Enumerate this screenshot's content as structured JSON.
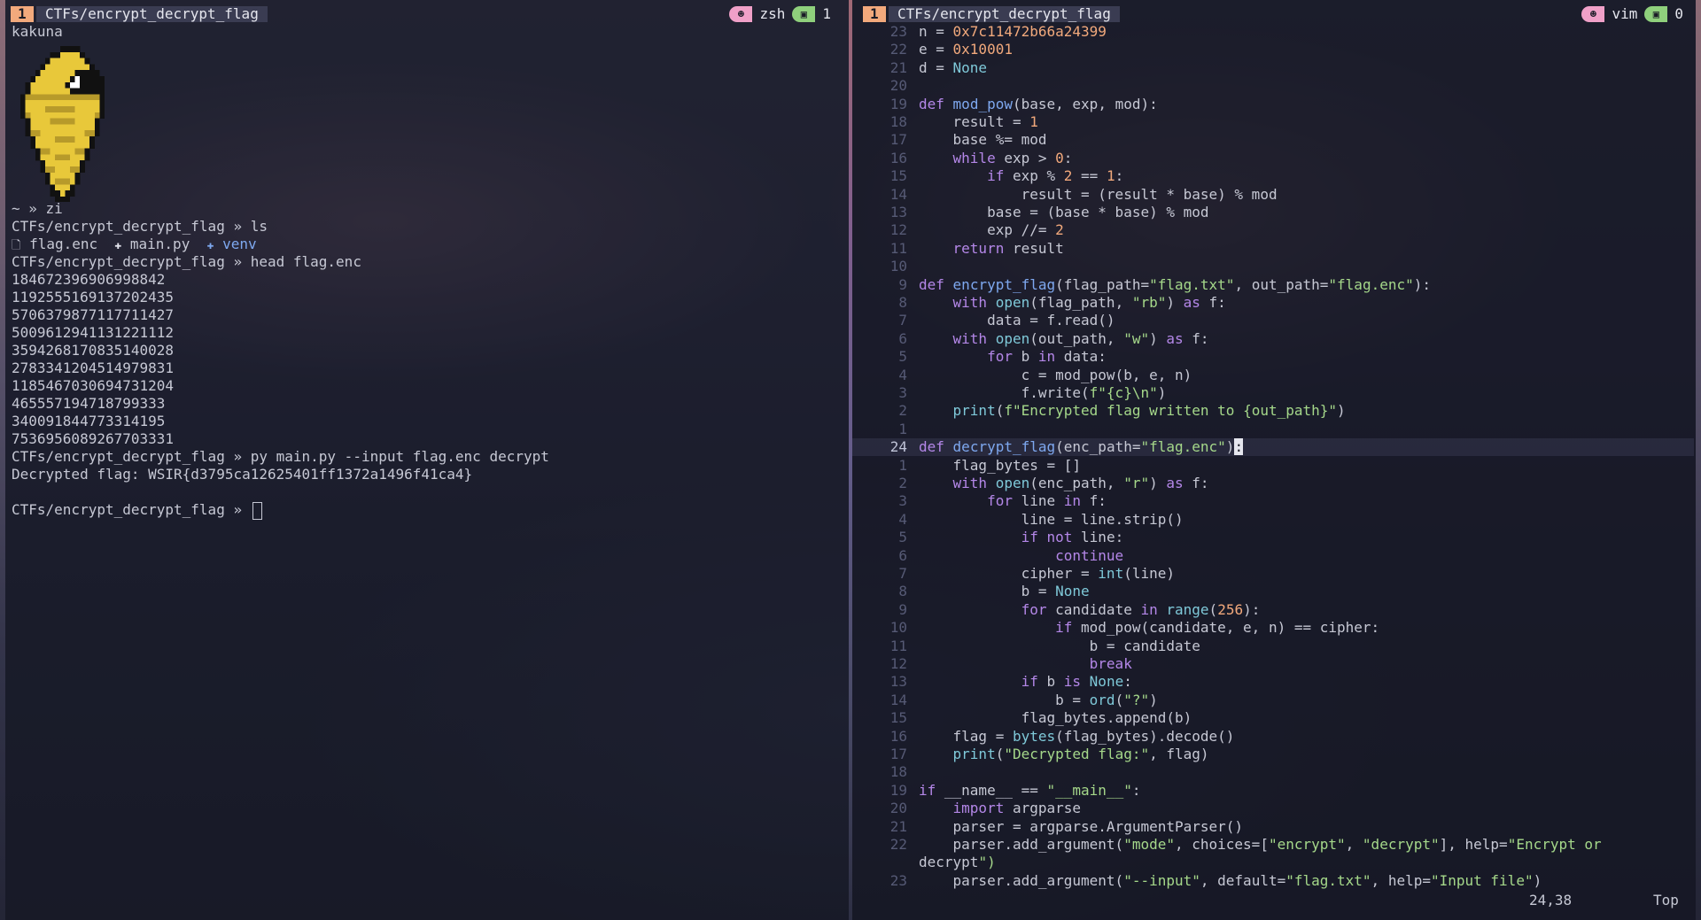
{
  "left_pane": {
    "status": {
      "window_index": "1",
      "title": "CTFs/encrypt_decrypt_flag",
      "program": "zsh",
      "pane_count": "1",
      "program_icon": "person-icon",
      "pane_icon": "terminal-icon"
    },
    "pokemon_name": "kakuna",
    "lines": [
      "~ » zi",
      "CTFs/encrypt_decrypt_flag » ls",
      "",
      "CTFs/encrypt_decrypt_flag » head flag.enc",
      "184672396906998842",
      "1192555169137202435",
      "5706379877117711427",
      "5009612941131221112",
      "3594268170835140028",
      "2783341204514979831",
      "1185467030694731204",
      "465557194718799333",
      "340091844773314195",
      "7536956089267703331",
      "CTFs/encrypt_decrypt_flag » py main.py --input flag.enc decrypt",
      "Decrypted flag: WSIR{d3795ca12625401ff1372a1496f41ca4}",
      "",
      "CTFs/encrypt_decrypt_flag » "
    ],
    "ls_items": [
      {
        "icon": "file-icon",
        "glyph": "🗋",
        "name": "flag.enc"
      },
      {
        "icon": "python-icon",
        "glyph": "✚",
        "name": "main.py"
      },
      {
        "icon": "venv-icon",
        "glyph": "✚",
        "name": "venv"
      }
    ]
  },
  "right_pane": {
    "status": {
      "window_index": "1",
      "title": "CTFs/encrypt_decrypt_flag",
      "program": "vim",
      "pane_count": "0",
      "program_icon": "person-icon",
      "pane_icon": "terminal-icon"
    },
    "cursor_position": "24,38",
    "scroll_position": "Top",
    "line_numbers": [
      "23",
      "22",
      "21",
      "20",
      "19",
      "18",
      "17",
      "16",
      "15",
      "14",
      "13",
      "12",
      "11",
      "10",
      "9",
      "8",
      "7",
      "6",
      "5",
      "4",
      "3",
      "2",
      "1",
      "24",
      "1",
      "2",
      "3",
      "4",
      "5",
      "6",
      "7",
      "8",
      "9",
      "10",
      "11",
      "12",
      "13",
      "14",
      "15",
      "16",
      "17",
      "18",
      "19",
      "20",
      "21",
      "22",
      "",
      "23"
    ],
    "code": [
      "n = 0x7c11472b66a24399",
      "e = 0x10001",
      "d = None",
      "",
      "def mod_pow(base, exp, mod):",
      "    result = 1",
      "    base %= mod",
      "    while exp > 0:",
      "        if exp % 2 == 1:",
      "            result = (result * base) % mod",
      "        base = (base * base) % mod",
      "        exp //= 2",
      "    return result",
      "",
      "def encrypt_flag(flag_path=\"flag.txt\", out_path=\"flag.enc\"):",
      "    with open(flag_path, \"rb\") as f:",
      "        data = f.read()",
      "    with open(out_path, \"w\") as f:",
      "        for b in data:",
      "            c = mod_pow(b, e, n)",
      "            f.write(f\"{c}\\n\")",
      "    print(f\"Encrypted flag written to {out_path}\")",
      "",
      "def decrypt_flag(enc_path=\"flag.enc\"):",
      "    flag_bytes = []",
      "    with open(enc_path, \"r\") as f:",
      "        for line in f:",
      "            line = line.strip()",
      "            if not line:",
      "                continue",
      "            cipher = int(line)",
      "            b = None",
      "            for candidate in range(256):",
      "                if mod_pow(candidate, e, n) == cipher:",
      "                    b = candidate",
      "                    break",
      "            if b is None:",
      "                b = ord(\"?\")",
      "            flag_bytes.append(b)",
      "    flag = bytes(flag_bytes).decode()",
      "    print(\"Decrypted flag:\", flag)",
      "",
      "if __name__ == \"__main__\":",
      "    import argparse",
      "    parser = argparse.ArgumentParser()",
      "    parser.add_argument(\"mode\", choices=[\"encrypt\", \"decrypt\"], help=\"Encrypt or",
      "decrypt\")",
      "    parser.add_argument(\"--input\", default=\"flag.txt\", help=\"Input file\")"
    ]
  },
  "colors": {
    "keyword": "#b487e8",
    "function": "#7ea8ef",
    "string": "#a5d88a",
    "number": "#f2a97c",
    "constant": "#7fc9d9",
    "window_badge": "#f2a97c",
    "pink_badge": "#f0a0c8",
    "green_badge": "#8fd07c"
  }
}
